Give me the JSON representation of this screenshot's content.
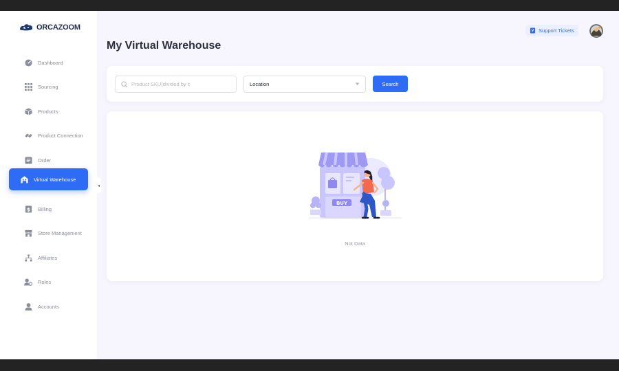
{
  "brand": {
    "orca": "ORCA",
    "zoom": "ZOOM"
  },
  "sidebar": {
    "items": [
      {
        "label": "Dashboard",
        "icon": "dashboard-icon"
      },
      {
        "label": "Sourcing",
        "icon": "grid-icon"
      },
      {
        "label": "Products",
        "icon": "box-icon"
      },
      {
        "label": "Product Connection",
        "icon": "link-icon"
      },
      {
        "label": "Order",
        "icon": "order-icon"
      },
      {
        "label": "Virtual Warehouse",
        "icon": "warehouse-icon",
        "active": true
      },
      {
        "label": "Billing",
        "icon": "billing-icon"
      },
      {
        "label": "Store Management",
        "icon": "store-icon"
      },
      {
        "label": "Affiliates",
        "icon": "affiliates-icon"
      },
      {
        "label": "Roles",
        "icon": "roles-icon"
      },
      {
        "label": "Accounts",
        "icon": "account-icon"
      }
    ]
  },
  "header": {
    "support_label": "Support Tickets"
  },
  "page": {
    "title": "My Virtual Warehouse"
  },
  "filters": {
    "sku_placeholder": "Product SKU(divided by c",
    "location_value": "Location",
    "search_label": "Search"
  },
  "empty": {
    "text": "Not Data",
    "buy_label": "BUY"
  },
  "colors": {
    "accent": "#2f6cf6",
    "background": "#f7f6fe"
  }
}
